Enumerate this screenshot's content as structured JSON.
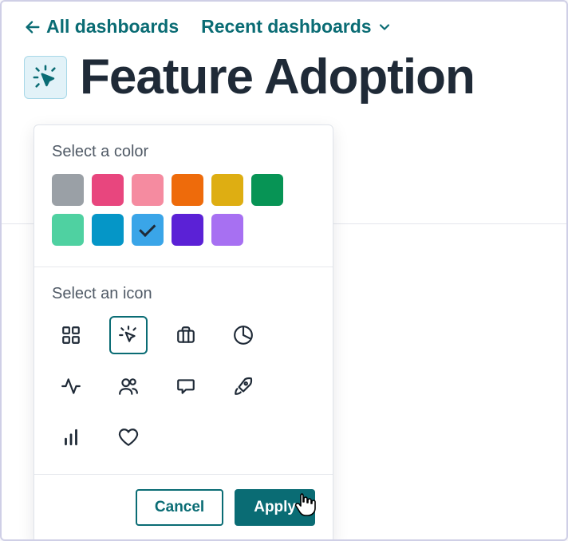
{
  "nav": {
    "back_label": "All dashboards",
    "recent_label": "Recent dashboards"
  },
  "page": {
    "title": "Feature Adoption"
  },
  "popover": {
    "color_title": "Select a color",
    "icon_title": "Select an icon",
    "cancel_label": "Cancel",
    "apply_label": "Apply",
    "colors": [
      {
        "name": "gray",
        "hex": "#9aa0a6",
        "selected": false
      },
      {
        "name": "pink-dark",
        "hex": "#e8467e",
        "selected": false
      },
      {
        "name": "pink-light",
        "hex": "#f58ba0",
        "selected": false
      },
      {
        "name": "orange",
        "hex": "#ee6b0b",
        "selected": false
      },
      {
        "name": "amber",
        "hex": "#deae12",
        "selected": false
      },
      {
        "name": "green-dark",
        "hex": "#079455",
        "selected": false
      },
      {
        "name": "green-light",
        "hex": "#4fd1a1",
        "selected": false
      },
      {
        "name": "cyan",
        "hex": "#0596c7",
        "selected": false
      },
      {
        "name": "blue",
        "hex": "#3aa5e8",
        "selected": true
      },
      {
        "name": "violet",
        "hex": "#5b21d6",
        "selected": false
      },
      {
        "name": "purple",
        "hex": "#a770f2",
        "selected": false
      }
    ],
    "icons": [
      {
        "name": "dashboard-icon",
        "selected": false
      },
      {
        "name": "cursor-click-icon",
        "selected": true
      },
      {
        "name": "briefcase-icon",
        "selected": false
      },
      {
        "name": "pie-chart-icon",
        "selected": false
      },
      {
        "name": "activity-icon",
        "selected": false
      },
      {
        "name": "users-icon",
        "selected": false
      },
      {
        "name": "chat-icon",
        "selected": false
      },
      {
        "name": "rocket-icon",
        "selected": false
      },
      {
        "name": "bar-chart-icon",
        "selected": false
      },
      {
        "name": "heart-icon",
        "selected": false
      }
    ]
  }
}
